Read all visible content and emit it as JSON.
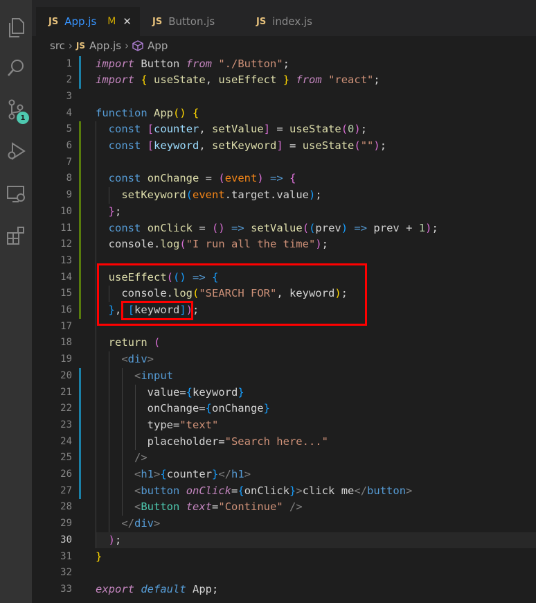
{
  "tabs": [
    {
      "badge": "JS",
      "label": "App.js",
      "modified": "M",
      "close": "✕",
      "active": true
    },
    {
      "badge": "JS",
      "label": "Button.js",
      "active": false
    },
    {
      "badge": "JS",
      "label": "index.js",
      "active": false
    }
  ],
  "breadcrumb": {
    "folder": "src",
    "file_badge": "JS",
    "file": "App.js",
    "symbol": "App"
  },
  "activity_badge": "1",
  "colors": {
    "accent": "#3794ff",
    "modified": "#cca700",
    "highlight": "#ff0000"
  },
  "highlight": {
    "target": "[keyword]"
  },
  "code": {
    "lines": [
      "import Button from \"./Button\";",
      "import { useState, useEffect } from \"react\";",
      "",
      "function App() {",
      "  const [counter, setValue] = useState(0);",
      "  const [keyword, setKeyword] = useState(\"\");",
      "",
      "  const onChange = (event) => {",
      "    setKeyword(event.target.value);",
      "  };",
      "  const onClick = () => setValue((prev) => prev + 1);",
      "  console.log(\"I run all the time\");",
      "",
      "  useEffect(() => {",
      "    console.log(\"SEARCH FOR\", keyword);",
      "  }, [keyword]);",
      "",
      "  return (",
      "    <div>",
      "      <input",
      "        value={keyword}",
      "        onChange={onChange}",
      "        type=\"text\"",
      "        placeholder=\"Search here...\"",
      "      />",
      "      <h1>{counter}</h1>",
      "      <button onClick={onClick}>click me</button>",
      "      <Button text=\"Continue\" />",
      "    </div>",
      "  );",
      "}",
      "",
      "export default App;"
    ]
  }
}
